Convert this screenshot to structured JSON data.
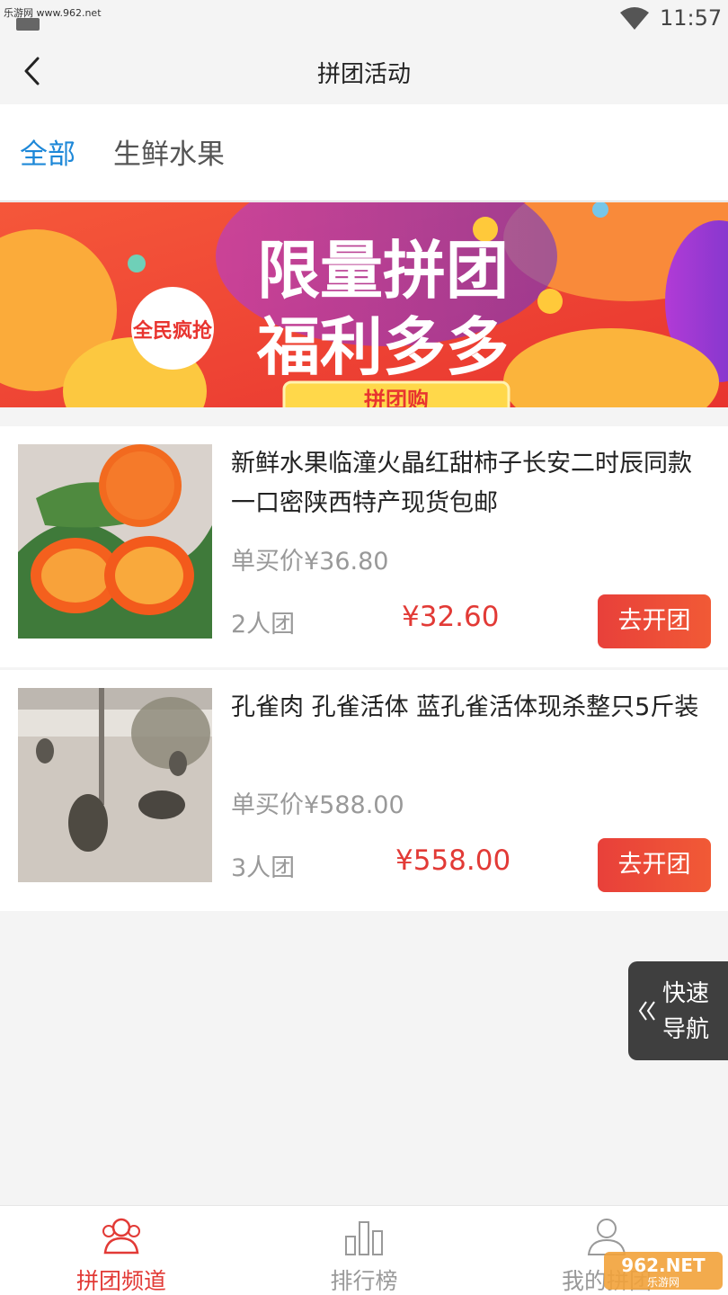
{
  "status_bar": {
    "watermark": "乐游网 www.962.net",
    "time": "11:57"
  },
  "header": {
    "title": "拼团活动"
  },
  "tabs": [
    {
      "label": "全部"
    },
    {
      "label": "生鲜水果"
    }
  ],
  "banner": {
    "line1": "限量拼团",
    "line2": "福利多多",
    "badge": "全民疯抢",
    "button": "拼团购"
  },
  "products": [
    {
      "title": "新鲜水果临潼火晶红甜柿子长安二时辰同款一口密陕西特产现货包邮",
      "solo_price": "单买价¥36.80",
      "group_size": "2人团",
      "group_price": "¥32.60",
      "button": "去开团"
    },
    {
      "title": "孔雀肉 孔雀活体 蓝孔雀活体现杀整只5斤装",
      "solo_price": "单买价¥588.00",
      "group_size": "3人团",
      "group_price": "¥558.00",
      "button": "去开团"
    }
  ],
  "quick_nav": {
    "label": "快速导航"
  },
  "bottom_nav": [
    {
      "label": "拼团频道",
      "icon": "users-icon"
    },
    {
      "label": "排行榜",
      "icon": "bar-chart-icon"
    },
    {
      "label": "我的拼团",
      "icon": "user-icon"
    }
  ],
  "corner_logo": {
    "text": "962.NET",
    "subtext": "乐游网"
  },
  "colors": {
    "accent_blue": "#1e88d8",
    "accent_red": "#e23a36",
    "button_red": "#ee4a38"
  }
}
